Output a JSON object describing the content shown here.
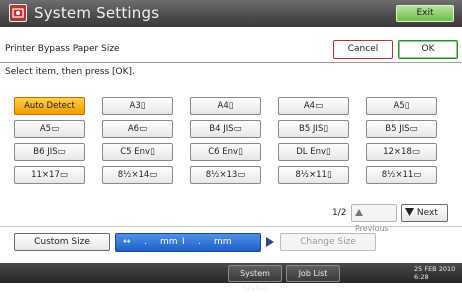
{
  "window": {
    "title": "System Settings",
    "title_icon": "system-settings-icon",
    "exit_label": "Exit"
  },
  "header": {
    "label": "Printer Bypass Paper Size",
    "cancel_label": "Cancel",
    "ok_label": "OK"
  },
  "instruction": "Select item, then press [OK].",
  "options": [
    {
      "label": "Auto Detect",
      "selected": true
    },
    {
      "label": "A3▯",
      "selected": false
    },
    {
      "label": "A4▯",
      "selected": false
    },
    {
      "label": "A4▭",
      "selected": false
    },
    {
      "label": "A5▯",
      "selected": false
    },
    {
      "label": "A5▭",
      "selected": false
    },
    {
      "label": "A6▭",
      "selected": false
    },
    {
      "label": "B4 JIS▭",
      "selected": false
    },
    {
      "label": "B5 JIS▯",
      "selected": false
    },
    {
      "label": "B5 JIS▭",
      "selected": false
    },
    {
      "label": "B6 JIS▭",
      "selected": false
    },
    {
      "label": "C5 Env▯",
      "selected": false
    },
    {
      "label": "C6 Env▯",
      "selected": false
    },
    {
      "label": "DL Env▯",
      "selected": false
    },
    {
      "label": "12×18▭",
      "selected": false
    },
    {
      "label": "11×17▭",
      "selected": false
    },
    {
      "label": "8½×14▭",
      "selected": false
    },
    {
      "label": "8½×13▭",
      "selected": false
    },
    {
      "label": "8½×11▯",
      "selected": false
    },
    {
      "label": "8½×11▭",
      "selected": false
    }
  ],
  "pagination": {
    "page_text": "1/2",
    "previous_label": "Previous",
    "next_label": "Next",
    "previous_icon": "triangle-up-icon",
    "next_icon": "triangle-down-icon"
  },
  "custom": {
    "custom_size_label": "Custom Size",
    "horizontal_arrow": "↔",
    "value1": ".",
    "unit1": "mm",
    "separator": "I",
    "value2": ".",
    "unit2": "mm",
    "change_size_label": "Change Size"
  },
  "statusbar": {
    "system_status_label": "System Status",
    "job_list_label": "Job List",
    "date": "25 FEB  2010",
    "time": "6:28"
  },
  "colors": {
    "selected_option": "#f5a300",
    "custom_field": "#2a6fd6",
    "exit_button": "#7cc450",
    "cancel_border": "#c03030",
    "ok_border": "#2a8a2a"
  }
}
